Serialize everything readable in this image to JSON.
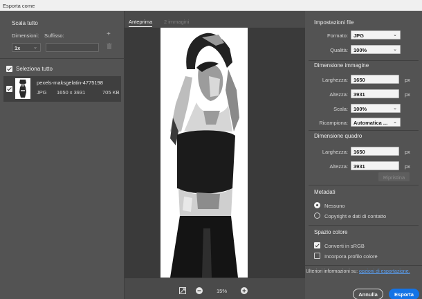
{
  "window": {
    "title": "Esporta come"
  },
  "left": {
    "scale_header": "Scala tutto",
    "dimensions_label": "Dimensioni:",
    "suffix_label": "Suffisso:",
    "add_symbol": "+",
    "scale_value": "1x",
    "suffix_placeholder": "",
    "select_all_label": "Seleziona tutto",
    "file": {
      "name": "pexels-maksgelatin-4775198",
      "format": "JPG",
      "dimensions": "1650 x 3931",
      "size": "705 KB"
    }
  },
  "center": {
    "tabs": [
      {
        "label": "Anteprima",
        "active": true
      },
      {
        "label": "2 immagini",
        "active": false
      }
    ],
    "zoom": "15%"
  },
  "right": {
    "file_settings": {
      "header": "Impostazioni file",
      "format_label": "Formato:",
      "format_value": "JPG",
      "quality_label": "Qualità:",
      "quality_value": "100%"
    },
    "image_size": {
      "header": "Dimensione immagine",
      "width_label": "Larghezza:",
      "width_value": "1650",
      "height_label": "Altezza:",
      "height_value": "3931",
      "scale_label": "Scala:",
      "scale_value": "100%",
      "resample_label": "Ricampiona:",
      "resample_value": "Automatica ...",
      "unit": "px"
    },
    "canvas_size": {
      "header": "Dimensione quadro",
      "width_label": "Larghezza:",
      "width_value": "1650",
      "height_label": "Altezza:",
      "height_value": "3931",
      "unit": "px",
      "reset_label": "Ripristina"
    },
    "metadata": {
      "header": "Metadati",
      "option_none": "Nessuno",
      "option_copyright": "Copyright e dati di contatto"
    },
    "color_space": {
      "header": "Spazio colore",
      "convert_label": "Converti in sRGB",
      "embed_label": "Incorpora profilo colore"
    },
    "footer": {
      "info_text": "Ulteriori informazioni su:",
      "info_link": "opzioni di esportazione."
    },
    "buttons": {
      "cancel": "Annulla",
      "export": "Esporta"
    }
  },
  "colors": {
    "accent": "#1473e6",
    "panel": "#535353",
    "link": "#5aa0f5"
  }
}
